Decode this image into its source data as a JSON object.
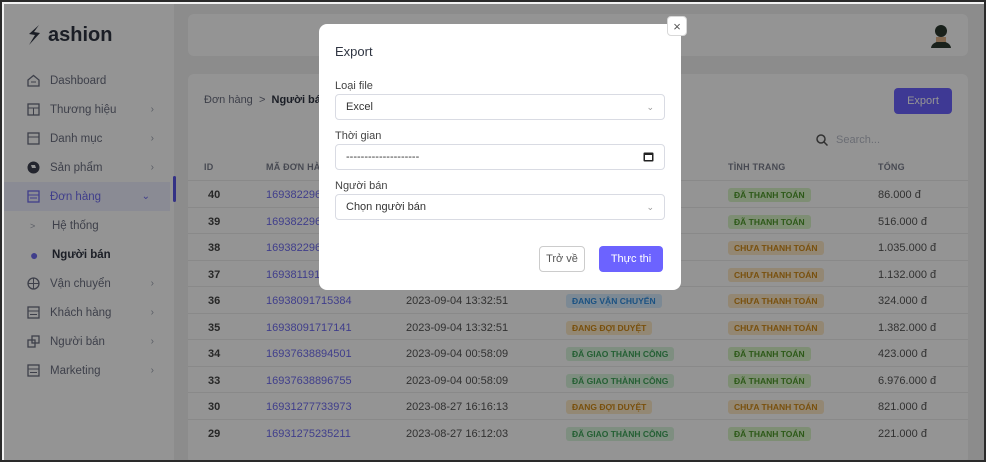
{
  "app": {
    "name": "ashion"
  },
  "sidebar": {
    "items": [
      {
        "label": "Dashboard",
        "icon": "home-icon",
        "chevron": ""
      },
      {
        "label": "Thương hiệu",
        "icon": "table-icon",
        "chevron": ">"
      },
      {
        "label": "Danh mục",
        "icon": "list-icon",
        "chevron": ">"
      },
      {
        "label": "Sản phẩm",
        "icon": "product-icon",
        "chevron": ">"
      },
      {
        "label": "Đơn hàng",
        "icon": "order-icon",
        "chevron": "v"
      }
    ],
    "subitems": [
      {
        "label": "Hệ thống",
        "bullet": ">"
      },
      {
        "label": "Người bán",
        "bullet": "●"
      }
    ],
    "items2": [
      {
        "label": "Vận chuyển",
        "icon": "shipping-icon",
        "chevron": ">"
      },
      {
        "label": "Khách hàng",
        "icon": "customer-icon",
        "chevron": ">"
      },
      {
        "label": "Người bán",
        "icon": "seller-icon",
        "chevron": ">"
      },
      {
        "label": "Marketing",
        "icon": "marketing-icon",
        "chevron": ">"
      }
    ]
  },
  "page": {
    "breadcrumb_root": "Đơn hàng",
    "breadcrumb_sep": ">",
    "breadcrumb_current": "Người bán",
    "export_label": "Export",
    "search_placeholder": "Search..."
  },
  "table": {
    "headers": {
      "id": "ID",
      "code": "MÃ ĐƠN HÀNG",
      "pay": "TÌNH TRANG",
      "total": "TỔNG"
    },
    "rows": [
      {
        "id": "40",
        "code": "1693822968",
        "date": "",
        "ship": "",
        "pay": "ĐÃ THANH TOÁN",
        "total": "86.000 đ"
      },
      {
        "id": "39",
        "code": "1693822969",
        "date": "",
        "ship": "",
        "pay": "ĐÃ THANH TOÁN",
        "total": "516.000 đ"
      },
      {
        "id": "38",
        "code": "1693822968",
        "date": "",
        "ship": "",
        "pay": "CHƯA THANH TOÁN",
        "total": "1.035.000 đ"
      },
      {
        "id": "37",
        "code": "1693811915",
        "date": "",
        "ship": "",
        "pay": "CHƯA THANH TOÁN",
        "total": "1.132.000 đ"
      },
      {
        "id": "36",
        "code": "16938091715384",
        "date": "2023-09-04 13:32:51",
        "ship": "ĐANG VẬN CHUYỂN",
        "pay": "CHƯA THANH TOÁN",
        "total": "324.000 đ"
      },
      {
        "id": "35",
        "code": "16938091717141",
        "date": "2023-09-04 13:32:51",
        "ship": "ĐANG ĐỢI DUYỆT",
        "pay": "CHƯA THANH TOÁN",
        "total": "1.382.000 đ"
      },
      {
        "id": "34",
        "code": "16937638894501",
        "date": "2023-09-04 00:58:09",
        "ship": "ĐÃ GIAO THÀNH CÔNG",
        "pay": "ĐÃ THANH TOÁN",
        "total": "423.000 đ"
      },
      {
        "id": "33",
        "code": "16937638896755",
        "date": "2023-09-04 00:58:09",
        "ship": "ĐÃ GIAO THÀNH CÔNG",
        "pay": "ĐÃ THANH TOÁN",
        "total": "6.976.000 đ"
      },
      {
        "id": "30",
        "code": "16931277733973",
        "date": "2023-08-27 16:16:13",
        "ship": "ĐANG ĐỢI DUYỆT",
        "pay": "CHƯA THANH TOÁN",
        "total": "821.000 đ"
      },
      {
        "id": "29",
        "code": "16931275235211",
        "date": "2023-08-27 16:12:03",
        "ship": "ĐÃ GIAO THÀNH CÔNG",
        "pay": "ĐÃ THANH TOÁN",
        "total": "221.000 đ"
      }
    ]
  },
  "colors": {
    "accent": "#6c63ff",
    "paid_bg": "#d9f5c9",
    "paid_fg": "#4f9a2a",
    "unpaid_bg": "#fde9c7",
    "unpaid_fg": "#d08a17",
    "shipping_bg": "#d6ecff",
    "shipping_fg": "#2f8de0",
    "pending_bg": "#fdebc8",
    "pending_fg": "#d08a17",
    "done_bg": "#daf5dc",
    "done_fg": "#3fa45a"
  },
  "modal": {
    "title": "Export",
    "close": "×",
    "file_type_label": "Loại file",
    "file_type_value": "Excel",
    "time_label": "Thời gian",
    "time_value": "--------------------",
    "seller_label": "Người bán",
    "seller_value": "Chọn người bán",
    "back_label": "Trở về",
    "run_label": "Thực thi",
    "dropdown_arrow": "⌄"
  }
}
